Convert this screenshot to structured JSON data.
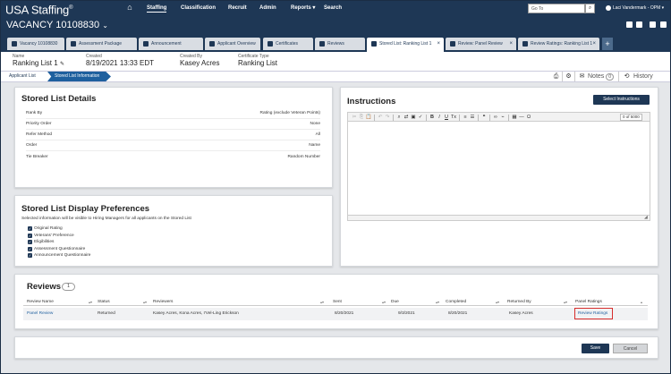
{
  "app": {
    "logo": "USA Staffing",
    "logo_mark": "®"
  },
  "nav": {
    "items": [
      {
        "label": "Staffing",
        "active": true
      },
      {
        "label": "Classification"
      },
      {
        "label": "Recruit"
      },
      {
        "label": "Admin"
      },
      {
        "label": "Reports"
      },
      {
        "label": "Search"
      }
    ],
    "goto_placeholder": "Go To",
    "user_name": "Laci Vandermark - OPM"
  },
  "vacancy": {
    "title": "VACANCY 10108830"
  },
  "tabs": [
    {
      "label": "Vacancy 10108830"
    },
    {
      "label": "Assessment Package"
    },
    {
      "label": "Announcement"
    },
    {
      "label": "Applicant Overview"
    },
    {
      "label": "Certificates"
    },
    {
      "label": "Reviews"
    },
    {
      "label": "Stored List: Ranking List 1",
      "active": true
    },
    {
      "label": "Review: Panel Review"
    },
    {
      "label": "Review Ratings: Ranking List 1"
    }
  ],
  "tab_close": "×",
  "tab_add": "+",
  "info": {
    "name_label": "Name",
    "name_value": "Ranking List 1",
    "created_label": "Created",
    "created_value": "8/19/2021 13:33 EDT",
    "created_by_label": "Created By",
    "created_by_value": "Kasey Acres",
    "cert_type_label": "Certificate Type",
    "cert_type_value": "Ranking List"
  },
  "breadcrumb": {
    "item1": "Applicant List",
    "item2": "Stored List Information"
  },
  "toolbar": {
    "notes_label": "Notes",
    "notes_count": "0",
    "history_label": "History"
  },
  "stored_list_details": {
    "title": "Stored List Details",
    "rows": [
      {
        "label": "Rank By",
        "value": "Rating (exclude Veteran Points)"
      },
      {
        "label": "Priority Order",
        "value": "None"
      },
      {
        "label": "Refer Method",
        "value": "All"
      },
      {
        "label": "Order",
        "value": "Name"
      },
      {
        "label": "Tie Breaker",
        "value": "Random Number"
      }
    ]
  },
  "display_prefs": {
    "title": "Stored List Display Preferences",
    "subtitle": "Selected information will be visible to Hiring Managers for all applicants on the Stored List",
    "options": [
      {
        "label": "Original Rating",
        "checked": true
      },
      {
        "label": "Veterans' Preference",
        "checked": true
      },
      {
        "label": "Eligibilities",
        "checked": true
      },
      {
        "label": "Assessment Questionnaire",
        "checked": true
      },
      {
        "label": "Announcement Questionnaire",
        "checked": true
      }
    ]
  },
  "instructions": {
    "title": "Instructions",
    "select_button": "Select Instructions",
    "char_count": "0 of 5000",
    "body": ""
  },
  "reviews": {
    "title": "Reviews",
    "count": "1",
    "columns": [
      "Review Name",
      "Status",
      "Reviewers",
      "Sent",
      "Due",
      "Completed",
      "Returned By",
      "Panel Ratings"
    ],
    "rows": [
      {
        "review_name": "Panel Review",
        "status": "Returned",
        "reviewers": "Kasey Acres, Kona Acres, I'Vel-Ling Erickson",
        "sent": "8/20/2021",
        "due": "9/3/2021",
        "completed": "8/20/2021",
        "returned_by": "Kasey Acres",
        "panel_ratings": "Review Ratings"
      }
    ]
  },
  "footer": {
    "save_label": "Save",
    "cancel_label": "Cancel"
  },
  "colors": {
    "navy": "#1e3755",
    "accent_blue": "#1e5f9e",
    "highlight_red": "#d62b2b"
  }
}
